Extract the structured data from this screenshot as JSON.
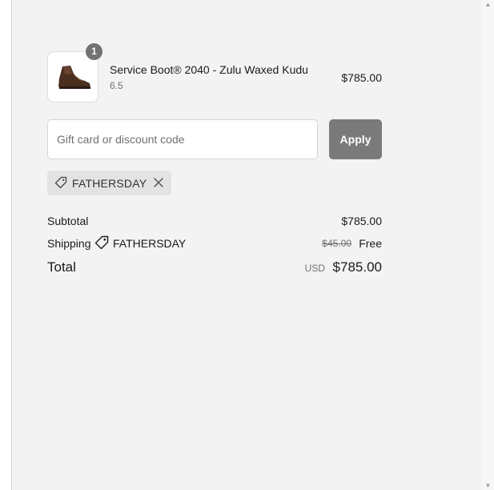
{
  "order": {
    "item": {
      "quantity": "1",
      "name": "Service Boot® 2040 - Zulu Waxed Kudu",
      "variant": "6.5",
      "price": "$785.00",
      "image_icon": "boot-icon"
    }
  },
  "discount": {
    "placeholder": "Gift card or discount code",
    "value": "",
    "apply_label": "Apply",
    "applied_code": "FATHERSDAY"
  },
  "summary": {
    "subtotal_label": "Subtotal",
    "subtotal_value": "$785.00",
    "shipping_label": "Shipping",
    "shipping_code": "FATHERSDAY",
    "shipping_original": "$45.00",
    "shipping_value": "Free",
    "total_label": "Total",
    "total_currency": "USD",
    "total_value": "$785.00"
  },
  "colors": {
    "panel_background": "#f3f3f3",
    "apply_button": "#7a7a7a",
    "badge": "#727272",
    "chip_background": "#e3e3e3"
  }
}
